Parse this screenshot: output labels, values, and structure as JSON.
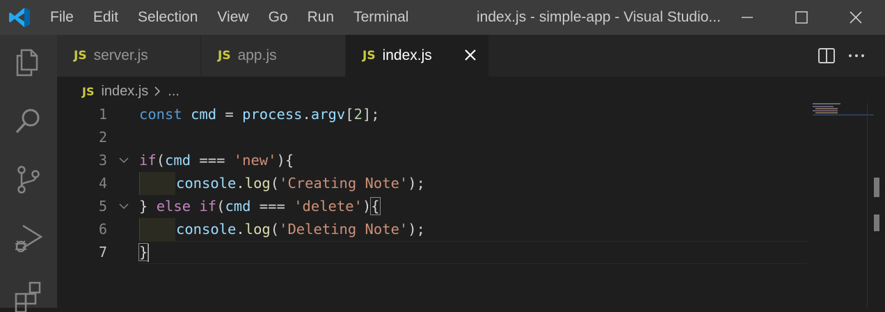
{
  "titlebar": {
    "menu": [
      "File",
      "Edit",
      "Selection",
      "View",
      "Go",
      "Run",
      "Terminal"
    ],
    "window_title": "index.js - simple-app - Visual Studio..."
  },
  "activitybar": {
    "items": [
      "explorer-icon",
      "search-icon",
      "source-control-icon",
      "run-debug-icon",
      "extensions-icon"
    ]
  },
  "tabs": [
    {
      "badge": "JS",
      "label": "server.js",
      "active": false
    },
    {
      "badge": "JS",
      "label": "app.js",
      "active": false
    },
    {
      "badge": "JS",
      "label": "index.js",
      "active": true
    }
  ],
  "breadcrumb": {
    "badge": "JS",
    "file": "index.js",
    "more": "..."
  },
  "editor": {
    "line_numbers": [
      "1",
      "2",
      "3",
      "4",
      "5",
      "6",
      "7"
    ],
    "current_line": 7,
    "colors": {
      "keyword": "#569cd6",
      "variable": "#9cdcfe",
      "function": "#dcdcaa",
      "string": "#ce9178",
      "number": "#b5cea8",
      "control": "#c586c0"
    },
    "lines": [
      {
        "t1": "const",
        "t2": "cmd",
        "t3": " = ",
        "t4": "process",
        "t5": ".",
        "t6": "argv",
        "t7": "[",
        "t8": "2",
        "t9": "];"
      },
      {},
      {
        "t1": "if",
        "t2": "(",
        "t3": "cmd",
        "t4": " === ",
        "t5": "'new'",
        "t6": "){"
      },
      {
        "t1": "console",
        "t2": ".",
        "t3": "log",
        "t4": "(",
        "t5": "'Creating Note'",
        "t6": ");"
      },
      {
        "t1": "} ",
        "t2": "else",
        "t3": " ",
        "t4": "if",
        "t5": "(",
        "t6": "cmd",
        "t7": " === ",
        "t8": "'delete'",
        "t9": ")",
        "t10": "{"
      },
      {
        "t1": "console",
        "t2": ".",
        "t3": "log",
        "t4": "(",
        "t5": "'Deleting Note'",
        "t6": ");"
      },
      {
        "t1": "}"
      }
    ]
  }
}
